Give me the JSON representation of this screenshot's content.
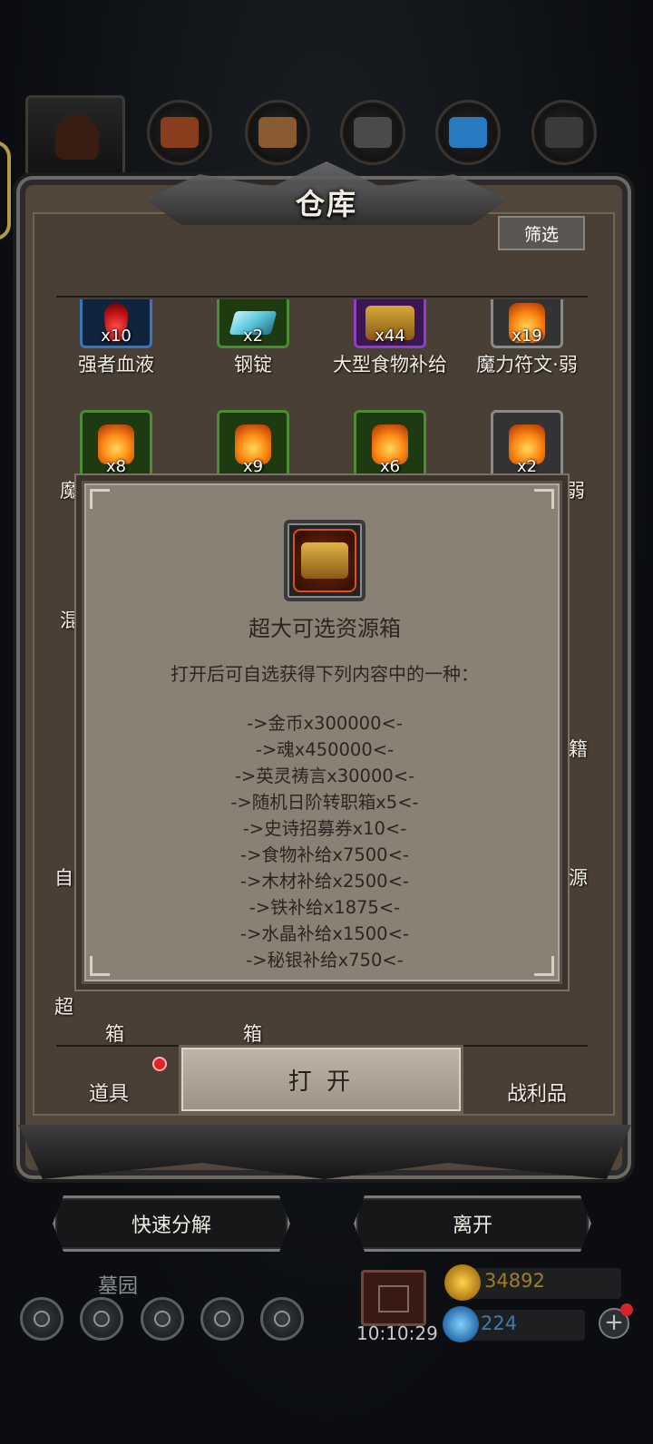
{
  "panel": {
    "title": "仓库",
    "filter_label": "筛选"
  },
  "items_row1": [
    {
      "label": "强者血液",
      "count": "x10",
      "frame": "blue",
      "art": "blood"
    },
    {
      "label": "钢锭",
      "count": "x2",
      "frame": "green",
      "art": "ingot"
    },
    {
      "label": "大型食物补给",
      "count": "x44",
      "frame": "purple",
      "art": "chest"
    },
    {
      "label": "魔力符文·弱",
      "count": "x19",
      "frame": "gray",
      "art": "fire"
    }
  ],
  "items_row2": [
    {
      "count": "x8",
      "frame": "green",
      "art": "fire"
    },
    {
      "count": "x9",
      "frame": "green",
      "art": "fire"
    },
    {
      "count": "x6",
      "frame": "green",
      "art": "fire"
    },
    {
      "count": "x2",
      "frame": "gray",
      "art": "fire"
    }
  ],
  "partial_labels": {
    "left_1": "魔",
    "right_1": "弱",
    "left_2": "混",
    "right_2": "籍",
    "left_3": "自",
    "right_3": "源",
    "left_4": "超",
    "bottom_1": "箱",
    "bottom_2": "箱"
  },
  "popup": {
    "title": "超大可选资源箱",
    "description": "打开后可自选获得下列内容中的一种：",
    "options": [
      "->金币x300000<-",
      "->魂x450000<-",
      "->英灵祷言x30000<-",
      "->随机日阶转职箱x5<-",
      "->史诗招募券x10<-",
      "->食物补给x7500<-",
      "->木材补给x2500<-",
      "->铁补给x1875<-",
      "->水晶补给x1500<-",
      "->秘银补给x750<-"
    ]
  },
  "tabs": {
    "left": "道具",
    "open": "打 开",
    "right": "战利品"
  },
  "actions": {
    "decompose": "快速分解",
    "leave": "离开"
  },
  "bottom": {
    "area_name": "墓园",
    "timer": "10:10:29",
    "gold": "34892",
    "gems": "224"
  },
  "colors": {
    "panel_bg": "#52463a",
    "popup_bg": "#8a8175",
    "frame_green": "#4e8b35",
    "frame_blue": "#3e74b4",
    "frame_purple": "#8f3fc6",
    "notification_red": "#e0222a"
  }
}
